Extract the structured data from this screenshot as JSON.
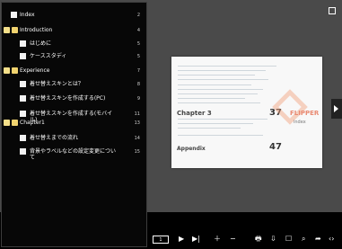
{
  "toc": [
    {
      "label": "Index",
      "page": "2",
      "type": "page",
      "indent": 0
    },
    {
      "label": "Introduction",
      "page": "4",
      "type": "folder",
      "indent": 0
    },
    {
      "label": "はじめに",
      "page": "5",
      "type": "page",
      "indent": 1
    },
    {
      "label": "ケーススタディ",
      "page": "5",
      "type": "page",
      "indent": 1
    },
    {
      "label": "Experience",
      "page": "7",
      "type": "folder",
      "indent": 0
    },
    {
      "label": "着せ替えスキンとは？",
      "page": "8",
      "type": "page",
      "indent": 1
    },
    {
      "label": "着せ替えスキンを作成する(PC)",
      "page": "9",
      "type": "page",
      "indent": 1
    },
    {
      "label": "着せ替えスキンを作成する(モバイル)",
      "page": "11",
      "type": "page",
      "indent": 1
    },
    {
      "label": "Chapter1",
      "page": "13",
      "type": "folder",
      "indent": 0
    },
    {
      "label": "着せ替えまでの流れ",
      "page": "14",
      "type": "page",
      "indent": 1
    },
    {
      "label": "背景やラベルなどの設定変更について",
      "page": "15",
      "type": "page",
      "indent": 1
    }
  ],
  "doc_page": {
    "chapter": "Chapter 3",
    "chapter_page": "37",
    "appendix": "Appendix",
    "appendix_page": "47",
    "brand": "FLIPPER",
    "brand_sub": "index"
  },
  "toolbar": {
    "page_input": "1"
  }
}
